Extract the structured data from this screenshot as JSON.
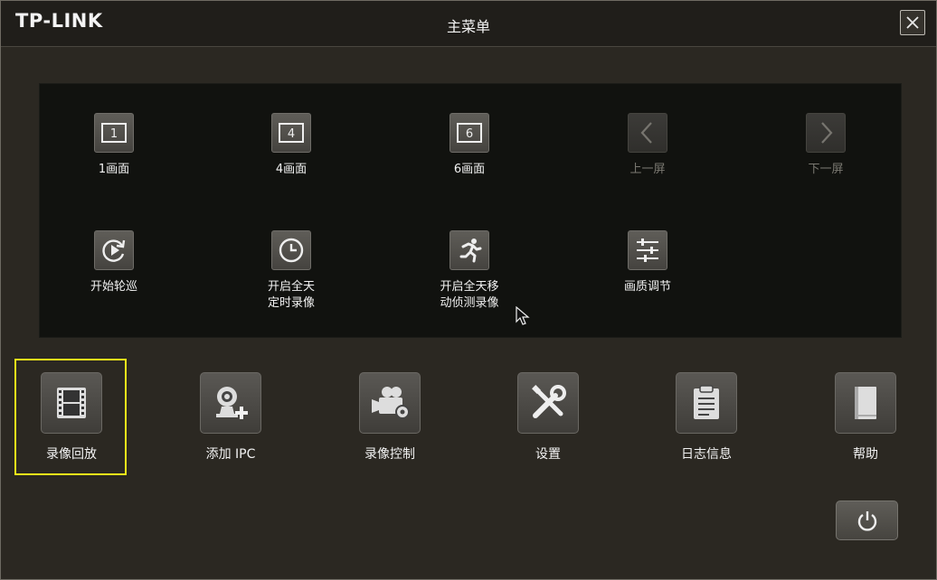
{
  "window": {
    "logo": "TP-LINK",
    "title": "主菜单"
  },
  "panel": {
    "items": [
      {
        "label": "1画面",
        "icon": "layout-1-icon",
        "enabled": true
      },
      {
        "label": "4画面",
        "icon": "layout-4-icon",
        "enabled": true
      },
      {
        "label": "6画面",
        "icon": "layout-6-icon",
        "enabled": true
      },
      {
        "label": "上一屏",
        "icon": "chevron-left-icon",
        "enabled": false
      },
      {
        "label": "下一屏",
        "icon": "chevron-right-icon",
        "enabled": false
      },
      {
        "label": "开始轮巡",
        "icon": "cycle-icon",
        "enabled": true
      },
      {
        "label": "开启全天\n定时录像",
        "icon": "clock-icon",
        "enabled": true
      },
      {
        "label": "开启全天移\n动侦测录像",
        "icon": "motion-runner-icon",
        "enabled": true
      },
      {
        "label": "画质调节",
        "icon": "sliders-icon",
        "enabled": true
      }
    ]
  },
  "main_menu": {
    "items": [
      {
        "label": "录像回放",
        "icon": "film-icon",
        "selected": true
      },
      {
        "label": "添加 IPC",
        "icon": "add-camera-icon",
        "selected": false
      },
      {
        "label": "录像控制",
        "icon": "video-camera-gear-icon",
        "selected": false
      },
      {
        "label": "设置",
        "icon": "tools-icon",
        "selected": false
      },
      {
        "label": "日志信息",
        "icon": "clipboard-icon",
        "selected": false
      },
      {
        "label": "帮助",
        "icon": "book-icon",
        "selected": false
      }
    ]
  },
  "colors": {
    "selection": "#f3ea1a",
    "background": "#2b2822",
    "panel": "#11120f"
  }
}
